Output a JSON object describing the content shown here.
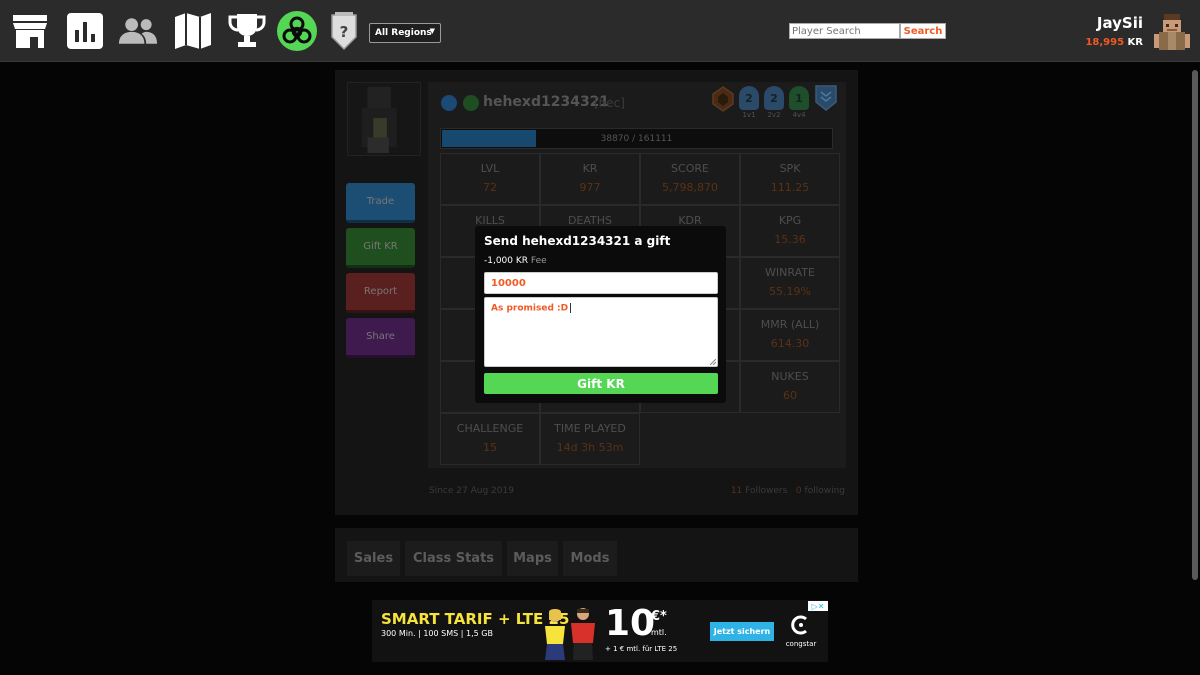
{
  "header": {
    "nav_icons": [
      "store-icon",
      "stats-icon",
      "friends-icon",
      "map-icon",
      "trophy-icon",
      "biohazard-icon",
      "unknown-rank-icon"
    ],
    "region_select": "All Regions",
    "search_placeholder": "Player Search",
    "search_button": "Search",
    "username": "JaySii",
    "kr_amount": "18,995",
    "kr_unit": "KR"
  },
  "profile": {
    "name": "hehexd1234321",
    "clan": "[hec]",
    "actions": [
      "Trade",
      "Gift KR",
      "Report",
      "Share"
    ],
    "action_colors": [
      "#1c4d73",
      "#1f4f1f",
      "#5a1f1f",
      "#3e1a4f"
    ],
    "rank_badges": [
      {
        "value": "2",
        "label": "1v1"
      },
      {
        "value": "2",
        "label": "2v2"
      },
      {
        "value": "1",
        "label": "4v4"
      }
    ],
    "xp_text": "38870 / 161111",
    "xp_progress": 0.241,
    "stats": [
      {
        "label": "LVL",
        "value": "72"
      },
      {
        "label": "KR",
        "value": "977"
      },
      {
        "label": "SCORE",
        "value": "5,798,870"
      },
      {
        "label": "SPK",
        "value": "111.25"
      },
      {
        "label": "KILLS",
        "value": ""
      },
      {
        "label": "DEATHS",
        "value": ""
      },
      {
        "label": "KDR",
        "value": ""
      },
      {
        "label": "KPG",
        "value": "15.36"
      },
      {
        "label": "",
        "value": ""
      },
      {
        "label": "",
        "value": ""
      },
      {
        "label": "",
        "value": ""
      },
      {
        "label": "WINRATE",
        "value": "55.19%"
      },
      {
        "label": "",
        "value": ""
      },
      {
        "label": "",
        "value": ""
      },
      {
        "label": "",
        "value": ""
      },
      {
        "label": "MMR (ALL)",
        "value": "614.30"
      },
      {
        "label": "",
        "value": ""
      },
      {
        "label": "",
        "value": ""
      },
      {
        "label": "",
        "value": ""
      },
      {
        "label": "NUKES",
        "value": "60"
      },
      {
        "label": "CHALLENGE",
        "value": "15"
      },
      {
        "label": "TIME PLAYED",
        "value": "14d 3h 53m"
      }
    ],
    "since": "Since 27 Aug 2019",
    "followers_count": "11",
    "followers_label": "Followers",
    "following_count": "0",
    "following_label": "following"
  },
  "tabs": [
    "Sales",
    "Class Stats",
    "Maps",
    "Mods"
  ],
  "ad": {
    "headline": "SMART TARIF + LTE 25",
    "subline": "300 Min. | 100 SMS | 1,5 GB",
    "price": "10",
    "price_unit": "€*",
    "price_period": "mtl.",
    "price_note": "+ 1 € mtl. für LTE 25",
    "cta": "Jetzt sichern",
    "brand": "congstar",
    "close_icon": "▷✕"
  },
  "gift_modal": {
    "title": "Send hehexd1234321 a gift",
    "fee_amount": "-1,000 KR",
    "fee_word": "Fee",
    "amount_value": "10000",
    "message_value": "As promised :D",
    "submit": "Gift KR"
  },
  "colors": {
    "accent_orange": "#f05a24",
    "gift_green": "#55d755",
    "topbar": "#2b2b2b"
  }
}
